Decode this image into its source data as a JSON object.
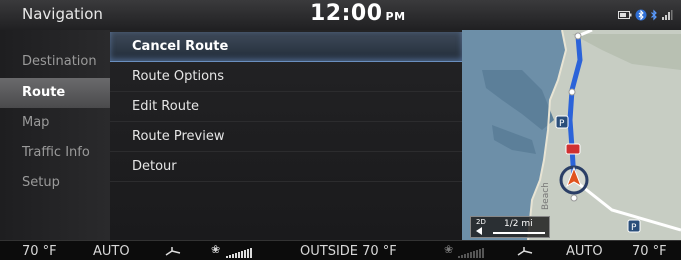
{
  "header": {
    "title": "Navigation",
    "time": "12:00",
    "ampm": "PM"
  },
  "sidebar": {
    "items": [
      {
        "label": "Destination",
        "active": false
      },
      {
        "label": "Route",
        "active": true
      },
      {
        "label": "Map",
        "active": false
      },
      {
        "label": "Traffic Info",
        "active": false
      },
      {
        "label": "Setup",
        "active": false
      }
    ]
  },
  "menu": {
    "items": [
      {
        "label": "Cancel Route",
        "selected": true
      },
      {
        "label": "Route Options",
        "selected": false
      },
      {
        "label": "Edit Route",
        "selected": false
      },
      {
        "label": "Route Preview",
        "selected": false
      },
      {
        "label": "Detour",
        "selected": false
      }
    ]
  },
  "map": {
    "view_mode": "2D",
    "scale": "1/2 mi",
    "label_beach": "Beach",
    "route_color": "#2b63d9",
    "water_color": "#6d8fa8"
  },
  "climate": {
    "left_temp": "70 °F",
    "left_mode": "AUTO",
    "outside": "OUTSIDE  70 °F",
    "right_mode": "AUTO",
    "right_temp": "70 °F"
  }
}
